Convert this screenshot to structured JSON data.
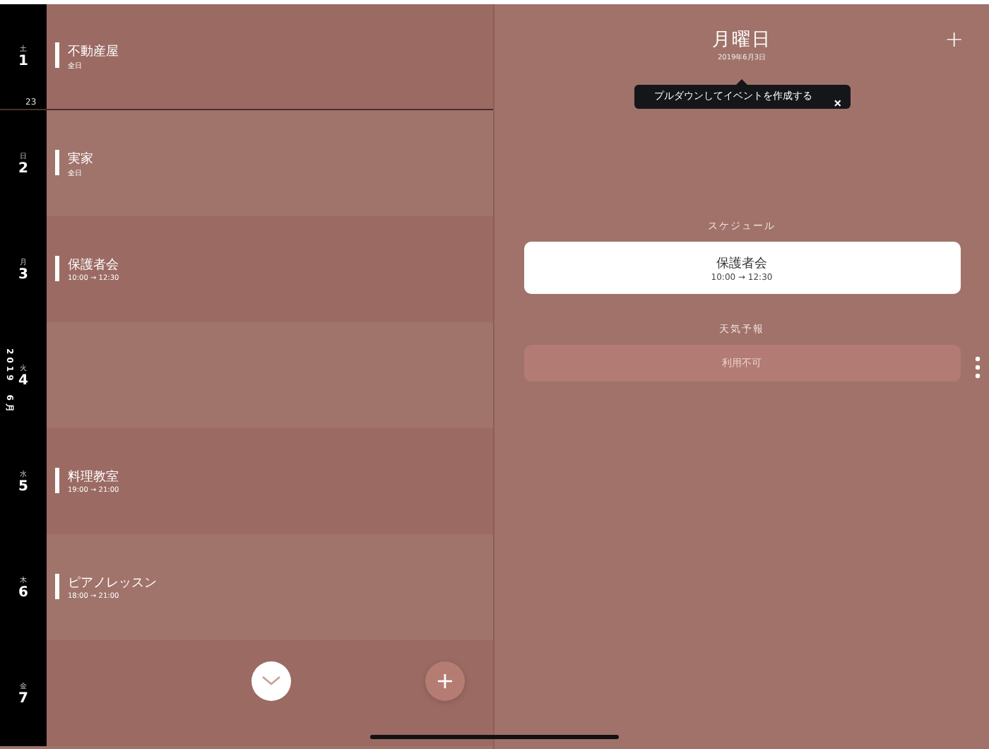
{
  "month_label": {
    "year": "2019",
    "month": "6月"
  },
  "days": [
    {
      "weekday": "土",
      "day": "1",
      "week_marker": "23",
      "event": {
        "title": "不動産屋",
        "time": "全日"
      }
    },
    {
      "weekday": "日",
      "day": "2",
      "event": {
        "title": "実家",
        "time": "全日"
      }
    },
    {
      "weekday": "月",
      "day": "3",
      "event": {
        "title": "保護者会",
        "time": "10:00 → 12:30"
      }
    },
    {
      "weekday": "火",
      "day": "4"
    },
    {
      "weekday": "水",
      "day": "5",
      "event": {
        "title": "料理教室",
        "time": "19:00 → 21:00"
      }
    },
    {
      "weekday": "木",
      "day": "6",
      "event": {
        "title": "ピアノレッスン",
        "time": "18:00 → 21:00"
      }
    },
    {
      "weekday": "金",
      "day": "7"
    }
  ],
  "detail": {
    "title": "月曜日",
    "date": "2019年6月3日",
    "add_button": "+",
    "tooltip": {
      "text": "プルダウンしてイベントを作成する",
      "close": "×"
    },
    "schedule_heading": "スケジュール",
    "schedule": [
      {
        "title": "保護者会",
        "time": "10:00 → 12:30"
      }
    ],
    "weather_heading": "天気予報",
    "weather": "利用不可"
  },
  "fab_add": "+"
}
